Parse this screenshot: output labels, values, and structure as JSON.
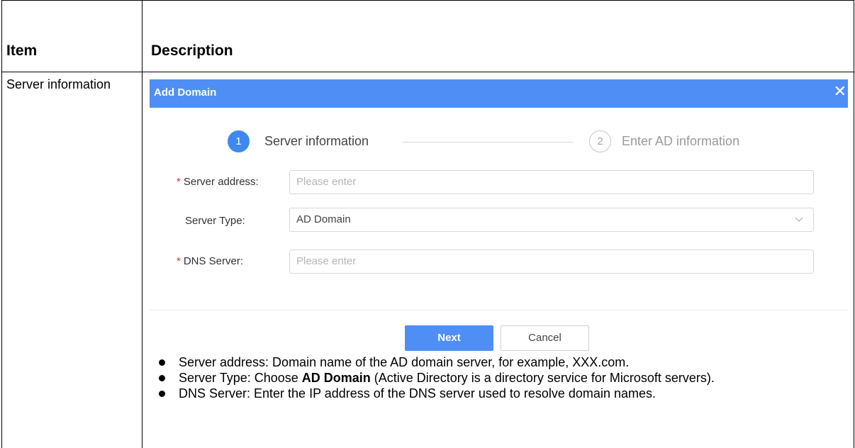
{
  "table": {
    "header_item": "Item",
    "header_description": "Description",
    "item_text": "Server information"
  },
  "dialog": {
    "title": "Add Domain",
    "close_glyph": "✕",
    "steps": [
      {
        "number": "1",
        "label": "Server information"
      },
      {
        "number": "2",
        "label": "Enter AD information"
      }
    ],
    "fields": {
      "server_address": {
        "required_mark": "*",
        "label": "Server address:",
        "placeholder": "Please enter"
      },
      "server_type": {
        "label": "Server Type:",
        "value": "AD Domain"
      },
      "dns_server": {
        "required_mark": "*",
        "label": "DNS Server:",
        "placeholder": "Please enter"
      }
    },
    "buttons": {
      "next": "Next",
      "cancel": "Cancel"
    },
    "colors": {
      "title_bar": "#4f8ff5",
      "active_step": "#3d89f0",
      "required": "#e0302f"
    }
  },
  "bullets": {
    "b1": "Server address: Domain name of the AD domain server, for example, XXX.com.",
    "b2_prefix": "Server Type: Choose ",
    "b2_bold": "AD Domain",
    "b2_suffix": " (Active Directory is a directory service for Microsoft servers).",
    "b3": "DNS Server: Enter the IP address of the DNS server used to resolve domain names."
  }
}
